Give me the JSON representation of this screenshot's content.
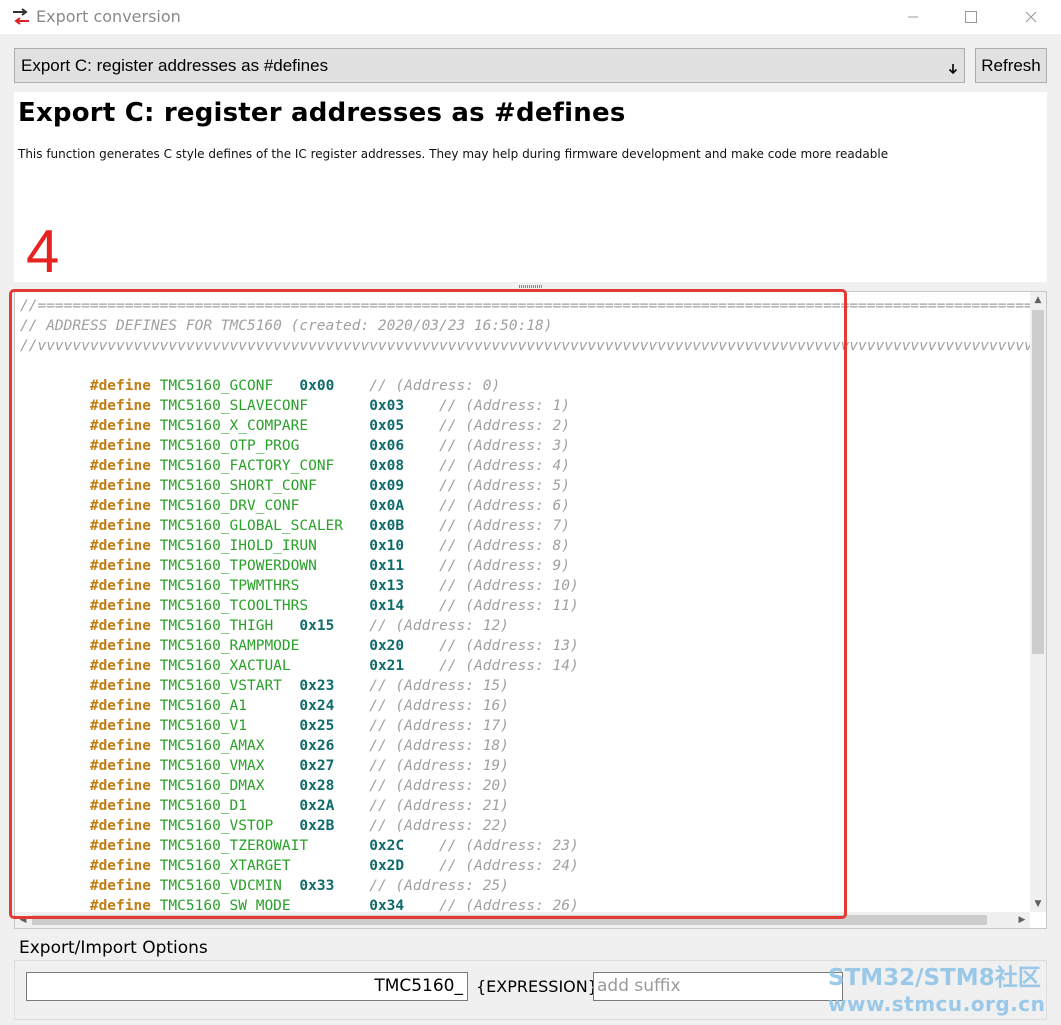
{
  "window": {
    "title": "Export conversion",
    "minimize_glyph": "—",
    "maximize_glyph": "☐",
    "close_glyph": "✕"
  },
  "toolbar": {
    "selected_export": "Export C: register addresses as #defines",
    "refresh_label": "Refresh"
  },
  "description": {
    "title": "Export C: register addresses as #defines",
    "text": "This function generates C style defines of the IC register addresses. They may help during firmware development and make code more readable"
  },
  "annotation": {
    "number": "4"
  },
  "code": {
    "header": [
      "//===========================================================================================================================================",
      "// ADDRESS DEFINES FOR TMC5160 (created: 2020/03/23 16:50:18)                                                                              /",
      "//vvvvvvvvvvvvvvvvvvvvvvvvvvvvvvvvvvvvvvvvvvvvvvvvvvvvvvvvvvvvvvvvvvvvvvvvvvvvvvvvvvvvvvvvvvvvvvvvvvvvvvvvvvvvvvvvvvvvvvvvvvvvvvvvvvvvvvvvvvvvv"
    ],
    "indent": "        ",
    "keyword": "#define",
    "defines": [
      {
        "name": "TMC5160_GCONF",
        "value": "0x00",
        "comment": "// (Address: 0)"
      },
      {
        "name": "TMC5160_SLAVECONF",
        "value": "0x03",
        "comment": "// (Address: 1)"
      },
      {
        "name": "TMC5160_X_COMPARE",
        "value": "0x05",
        "comment": "// (Address: 2)"
      },
      {
        "name": "TMC5160_OTP_PROG",
        "value": "0x06",
        "comment": "// (Address: 3)"
      },
      {
        "name": "TMC5160_FACTORY_CONF",
        "value": "0x08",
        "comment": "// (Address: 4)"
      },
      {
        "name": "TMC5160_SHORT_CONF",
        "value": "0x09",
        "comment": "// (Address: 5)"
      },
      {
        "name": "TMC5160_DRV_CONF",
        "value": "0x0A",
        "comment": "// (Address: 6)"
      },
      {
        "name": "TMC5160_GLOBAL_SCALER",
        "value": "0x0B",
        "comment": "// (Address: 7)"
      },
      {
        "name": "TMC5160_IHOLD_IRUN",
        "value": "0x10",
        "comment": "// (Address: 8)"
      },
      {
        "name": "TMC5160_TPOWERDOWN",
        "value": "0x11",
        "comment": "// (Address: 9)"
      },
      {
        "name": "TMC5160_TPWMTHRS",
        "value": "0x13",
        "comment": "// (Address: 10)"
      },
      {
        "name": "TMC5160_TCOOLTHRS",
        "value": "0x14",
        "comment": "// (Address: 11)"
      },
      {
        "name": "TMC5160_THIGH",
        "value": "0x15",
        "comment": "// (Address: 12)"
      },
      {
        "name": "TMC5160_RAMPMODE",
        "value": "0x20",
        "comment": "// (Address: 13)"
      },
      {
        "name": "TMC5160_XACTUAL",
        "value": "0x21",
        "comment": "// (Address: 14)"
      },
      {
        "name": "TMC5160_VSTART",
        "value": "0x23",
        "comment": "// (Address: 15)"
      },
      {
        "name": "TMC5160_A1",
        "value": "0x24",
        "comment": "// (Address: 16)"
      },
      {
        "name": "TMC5160_V1",
        "value": "0x25",
        "comment": "// (Address: 17)"
      },
      {
        "name": "TMC5160_AMAX",
        "value": "0x26",
        "comment": "// (Address: 18)"
      },
      {
        "name": "TMC5160_VMAX",
        "value": "0x27",
        "comment": "// (Address: 19)"
      },
      {
        "name": "TMC5160_DMAX",
        "value": "0x28",
        "comment": "// (Address: 20)"
      },
      {
        "name": "TMC5160_D1",
        "value": "0x2A",
        "comment": "// (Address: 21)"
      },
      {
        "name": "TMC5160_VSTOP",
        "value": "0x2B",
        "comment": "// (Address: 22)"
      },
      {
        "name": "TMC5160_TZEROWAIT",
        "value": "0x2C",
        "comment": "// (Address: 23)"
      },
      {
        "name": "TMC5160_XTARGET",
        "value": "0x2D",
        "comment": "// (Address: 24)"
      },
      {
        "name": "TMC5160_VDCMIN",
        "value": "0x33",
        "comment": "// (Address: 25)"
      },
      {
        "name": "TMC5160_SW_MODE",
        "value": "0x34",
        "comment": "// (Address: 26)"
      }
    ]
  },
  "options": {
    "section_label": "Export/Import Options",
    "prefix_value": "TMC5160_",
    "expression_label": "{EXPRESSION}",
    "suffix_placeholder": "add suffix"
  },
  "watermark": {
    "line1": "STM32/STM8社区",
    "line2": "www.stmcu.org.cn"
  },
  "colors": {
    "define_keyword": "#c17d11",
    "register_name": "#2aa02a",
    "hex_value": "#0f6b6b",
    "comment": "#a0a0a0",
    "annotation_red": "#e53935"
  }
}
